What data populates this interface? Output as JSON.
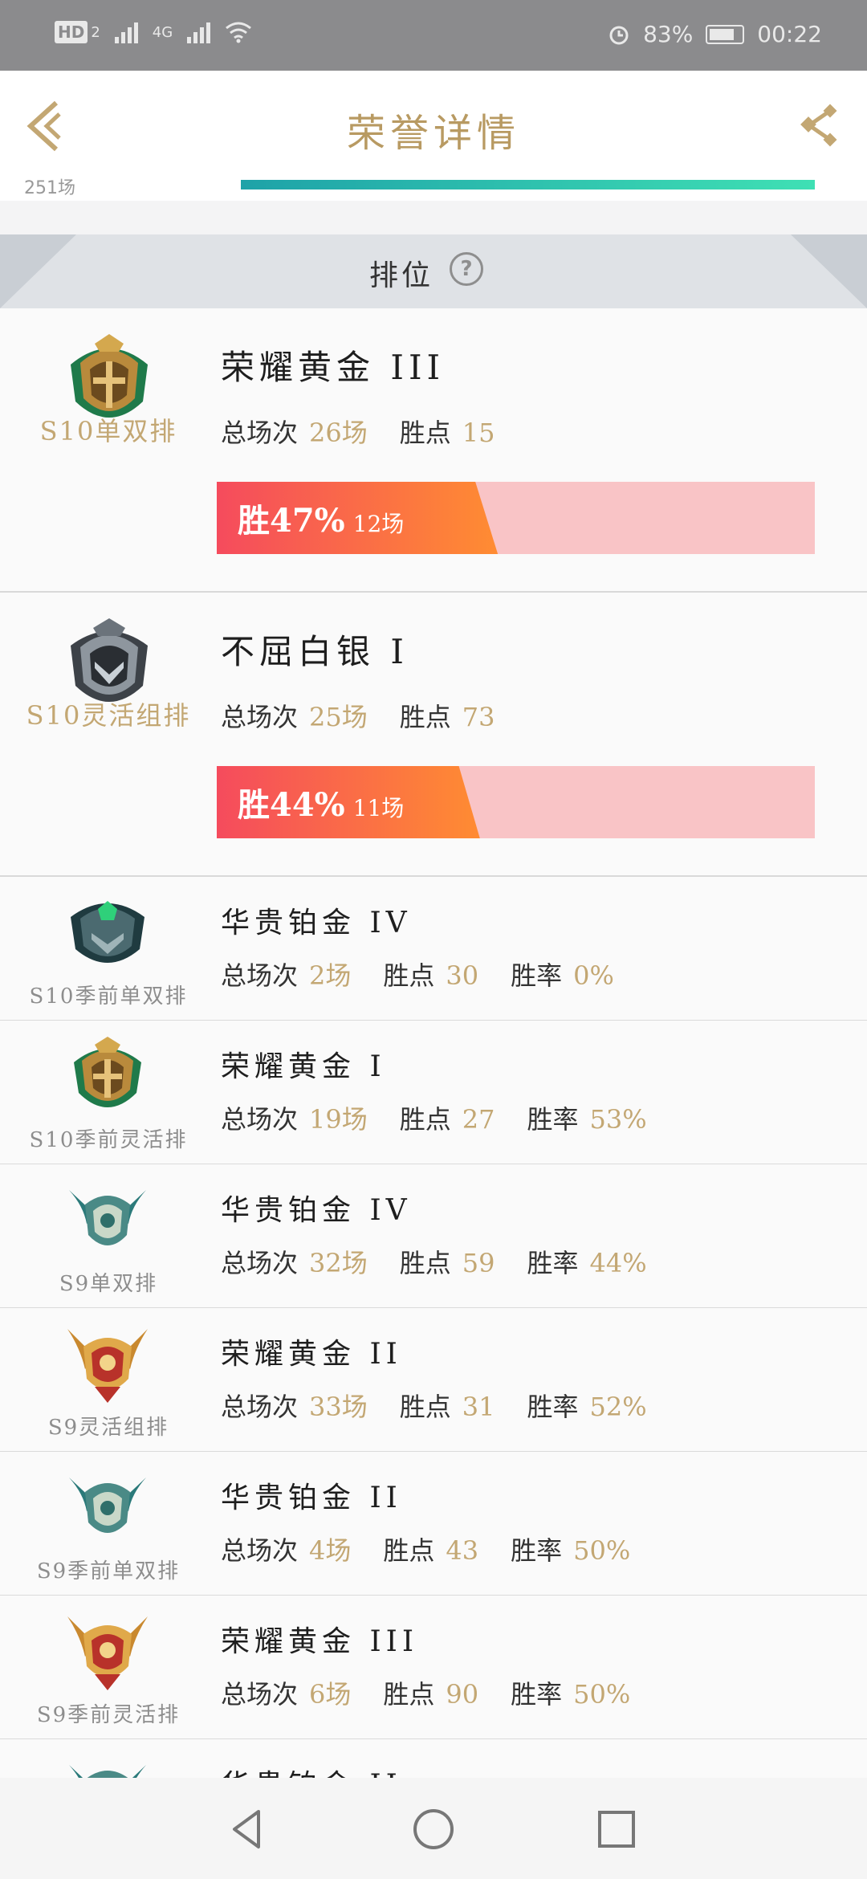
{
  "status_bar": {
    "hd": "HD",
    "sim": "2",
    "network": "4G",
    "battery": "83%",
    "time": "00:22"
  },
  "header": {
    "title": "荣誉详情"
  },
  "top_strip": {
    "partial_label": "251场"
  },
  "section": {
    "label": "排位",
    "help": "?"
  },
  "big_rows": [
    {
      "queue": "S10单双排",
      "rank": "荣耀黄金 III",
      "total_label": "总场次",
      "total": "26场",
      "lp_label": "胜点",
      "lp": "15",
      "win_label": "胜47%",
      "win_games": "12场",
      "win_rate": 0.47,
      "badge": "gold"
    },
    {
      "queue": "S10灵活组排",
      "rank": "不屈白银 I",
      "total_label": "总场次",
      "total": "25场",
      "lp_label": "胜点",
      "lp": "73",
      "win_label": "胜44%",
      "win_games": "11场",
      "win_rate": 0.44,
      "badge": "silver"
    }
  ],
  "small_rows": [
    {
      "queue": "S10季前单双排",
      "rank": "华贵铂金 IV",
      "total_label": "总场次",
      "total": "2场",
      "lp_label": "胜点",
      "lp": "30",
      "wr_label": "胜率",
      "wr": "0%",
      "badge": "platinum-dark"
    },
    {
      "queue": "S10季前灵活排",
      "rank": "荣耀黄金 I",
      "total_label": "总场次",
      "total": "19场",
      "lp_label": "胜点",
      "lp": "27",
      "wr_label": "胜率",
      "wr": "53%",
      "badge": "gold"
    },
    {
      "queue": "S9单双排",
      "rank": "华贵铂金 IV",
      "total_label": "总场次",
      "total": "32场",
      "lp_label": "胜点",
      "lp": "59",
      "wr_label": "胜率",
      "wr": "44%",
      "badge": "platinum"
    },
    {
      "queue": "S9灵活组排",
      "rank": "荣耀黄金 II",
      "total_label": "总场次",
      "total": "33场",
      "lp_label": "胜点",
      "lp": "31",
      "wr_label": "胜率",
      "wr": "52%",
      "badge": "gold-winged"
    },
    {
      "queue": "S9季前单双排",
      "rank": "华贵铂金 II",
      "total_label": "总场次",
      "total": "4场",
      "lp_label": "胜点",
      "lp": "43",
      "wr_label": "胜率",
      "wr": "50%",
      "badge": "platinum"
    },
    {
      "queue": "S9季前灵活排",
      "rank": "荣耀黄金 III",
      "total_label": "总场次",
      "total": "6场",
      "lp_label": "胜点",
      "lp": "90",
      "wr_label": "胜率",
      "wr": "50%",
      "badge": "gold-winged"
    }
  ],
  "partial_row": {
    "rank": "华贵铂金 II"
  },
  "colors": {
    "accent_gold": "#c3a773",
    "title_gold": "#b89a62",
    "win_from": "#f54b5d",
    "win_to": "#ff8c32",
    "win_bg": "#f9c4c6",
    "teal": "#1ea2a8"
  }
}
